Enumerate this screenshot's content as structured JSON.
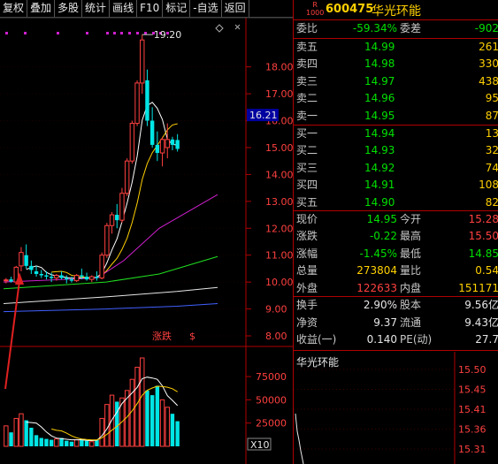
{
  "toolbar": {
    "items": [
      "复权",
      "叠加",
      "多股",
      "统计",
      "画线",
      "F10",
      "标记",
      "-自选",
      "返回"
    ]
  },
  "chart": {
    "price_axis": [
      "18.00",
      "17.00",
      "16.00",
      "15.00",
      "14.00",
      "13.00",
      "12.00",
      "11.00",
      "10.00",
      "9.00",
      "8.00"
    ],
    "current_price_label": "16.21",
    "high_label": "19.20",
    "volume_axis": [
      "75000",
      "50000",
      "25000"
    ],
    "volume_unit": "X10",
    "marker_text": "涨跌",
    "marker_symbol": "$"
  },
  "chart_data": {
    "type": "candlestick",
    "candles": [
      {
        "o": 10.05,
        "h": 10.15,
        "l": 9.95,
        "c": 10.08
      },
      {
        "o": 10.1,
        "h": 10.2,
        "l": 9.98,
        "c": 10.02
      },
      {
        "o": 10.0,
        "h": 10.6,
        "l": 9.95,
        "c": 10.55
      },
      {
        "o": 10.6,
        "h": 11.3,
        "l": 10.4,
        "c": 11.1
      },
      {
        "o": 11.0,
        "h": 11.4,
        "l": 10.5,
        "c": 10.6
      },
      {
        "o": 10.6,
        "h": 10.8,
        "l": 10.3,
        "c": 10.45
      },
      {
        "o": 10.4,
        "h": 10.6,
        "l": 10.2,
        "c": 10.3
      },
      {
        "o": 10.3,
        "h": 10.45,
        "l": 10.15,
        "c": 10.25
      },
      {
        "o": 10.25,
        "h": 10.4,
        "l": 10.1,
        "c": 10.2
      },
      {
        "o": 10.2,
        "h": 10.35,
        "l": 10.0,
        "c": 10.15
      },
      {
        "o": 10.15,
        "h": 10.3,
        "l": 10.05,
        "c": 10.25
      },
      {
        "o": 10.25,
        "h": 10.4,
        "l": 10.1,
        "c": 10.15
      },
      {
        "o": 10.15,
        "h": 10.25,
        "l": 9.95,
        "c": 10.1
      },
      {
        "o": 10.1,
        "h": 10.2,
        "l": 9.98,
        "c": 10.05
      },
      {
        "o": 10.05,
        "h": 10.3,
        "l": 10.0,
        "c": 10.25
      },
      {
        "o": 10.25,
        "h": 10.5,
        "l": 10.1,
        "c": 10.2
      },
      {
        "o": 10.2,
        "h": 10.35,
        "l": 10.05,
        "c": 10.1
      },
      {
        "o": 10.1,
        "h": 10.25,
        "l": 10.0,
        "c": 10.2
      },
      {
        "o": 10.2,
        "h": 10.4,
        "l": 10.05,
        "c": 10.15
      },
      {
        "o": 10.15,
        "h": 11.1,
        "l": 10.1,
        "c": 11.0
      },
      {
        "o": 11.0,
        "h": 12.2,
        "l": 10.9,
        "c": 12.1
      },
      {
        "o": 12.1,
        "h": 12.6,
        "l": 11.8,
        "c": 12.5
      },
      {
        "o": 12.5,
        "h": 12.9,
        "l": 12.0,
        "c": 12.3
      },
      {
        "o": 12.3,
        "h": 13.5,
        "l": 12.2,
        "c": 13.3
      },
      {
        "o": 13.3,
        "h": 14.6,
        "l": 13.2,
        "c": 14.5
      },
      {
        "o": 14.5,
        "h": 16.0,
        "l": 14.4,
        "c": 15.9
      },
      {
        "o": 15.9,
        "h": 17.5,
        "l": 15.8,
        "c": 17.4
      },
      {
        "o": 17.4,
        "h": 19.2,
        "l": 17.0,
        "c": 19.0
      },
      {
        "o": 17.5,
        "h": 17.9,
        "l": 15.8,
        "c": 16.0
      },
      {
        "o": 16.0,
        "h": 16.5,
        "l": 15.0,
        "c": 15.1
      },
      {
        "o": 15.1,
        "h": 15.6,
        "l": 14.5,
        "c": 14.8
      },
      {
        "o": 14.8,
        "h": 15.4,
        "l": 14.3,
        "c": 15.3
      },
      {
        "o": 15.0,
        "h": 15.9,
        "l": 14.6,
        "c": 15.3
      },
      {
        "o": 15.3,
        "h": 15.4,
        "l": 14.9,
        "c": 15.1
      },
      {
        "o": 15.28,
        "h": 15.5,
        "l": 14.85,
        "c": 14.95
      }
    ],
    "volumes": [
      22000,
      15000,
      30000,
      35000,
      28000,
      20000,
      12000,
      9000,
      8000,
      7000,
      8000,
      9000,
      6000,
      5000,
      7000,
      8000,
      6000,
      5000,
      7000,
      30000,
      45000,
      55000,
      48000,
      52000,
      60000,
      72000,
      85000,
      95000,
      60000,
      55000,
      65000,
      50000,
      42000,
      35000,
      27000
    ],
    "price_range": [
      8.0,
      19.5
    ],
    "volume_range": [
      0,
      95000
    ]
  },
  "stock": {
    "badge_top": "R",
    "badge_bottom": "1000",
    "code": "600475",
    "name": "华光环能"
  },
  "weibi": {
    "label1": "委比",
    "value1": "-59.34%",
    "label2": "委差",
    "value2": "-902"
  },
  "asks": [
    {
      "label": "卖五",
      "price": "14.99",
      "vol": "261"
    },
    {
      "label": "卖四",
      "price": "14.98",
      "vol": "330"
    },
    {
      "label": "卖三",
      "price": "14.97",
      "vol": "438"
    },
    {
      "label": "卖二",
      "price": "14.96",
      "vol": "95"
    },
    {
      "label": "卖一",
      "price": "14.95",
      "vol": "87"
    }
  ],
  "bids": [
    {
      "label": "买一",
      "price": "14.94",
      "vol": "13"
    },
    {
      "label": "买二",
      "price": "14.93",
      "vol": "32"
    },
    {
      "label": "买三",
      "price": "14.92",
      "vol": "74"
    },
    {
      "label": "买四",
      "price": "14.91",
      "vol": "108"
    },
    {
      "label": "买五",
      "price": "14.90",
      "vol": "82"
    }
  ],
  "quote": [
    {
      "l1": "现价",
      "v1": "14.95",
      "l2": "今开",
      "v2": "15.28"
    },
    {
      "l1": "涨跌",
      "v1": "-0.22",
      "l2": "最高",
      "v2": "15.50"
    },
    {
      "l1": "涨幅",
      "v1": "-1.45%",
      "l2": "最低",
      "v2": "14.85"
    },
    {
      "l1": "总量",
      "v1": "273804",
      "l2": "量比",
      "v2": "0.54"
    },
    {
      "l1": "外盘",
      "v1": "122633",
      "l2": "内盘",
      "v2": "151171"
    }
  ],
  "stats": [
    {
      "l1": "换手",
      "v1": "2.90%",
      "l2": "股本",
      "v2": "9.56亿"
    },
    {
      "l1": "净资",
      "v1": "9.37",
      "l2": "流通",
      "v2": "9.43亿"
    },
    {
      "l1": "收益(一)",
      "v1": "0.140",
      "l2": "PE(动)",
      "v2": "27.7"
    }
  ],
  "mini_chart": {
    "title": "华光环能",
    "axis": [
      "15.50",
      "15.45",
      "15.41",
      "15.36",
      "15.31"
    ]
  },
  "colors": {
    "up": "#ff4040",
    "down": "#00e5e5",
    "bg": "#000000",
    "grid_red": "#b00000"
  }
}
